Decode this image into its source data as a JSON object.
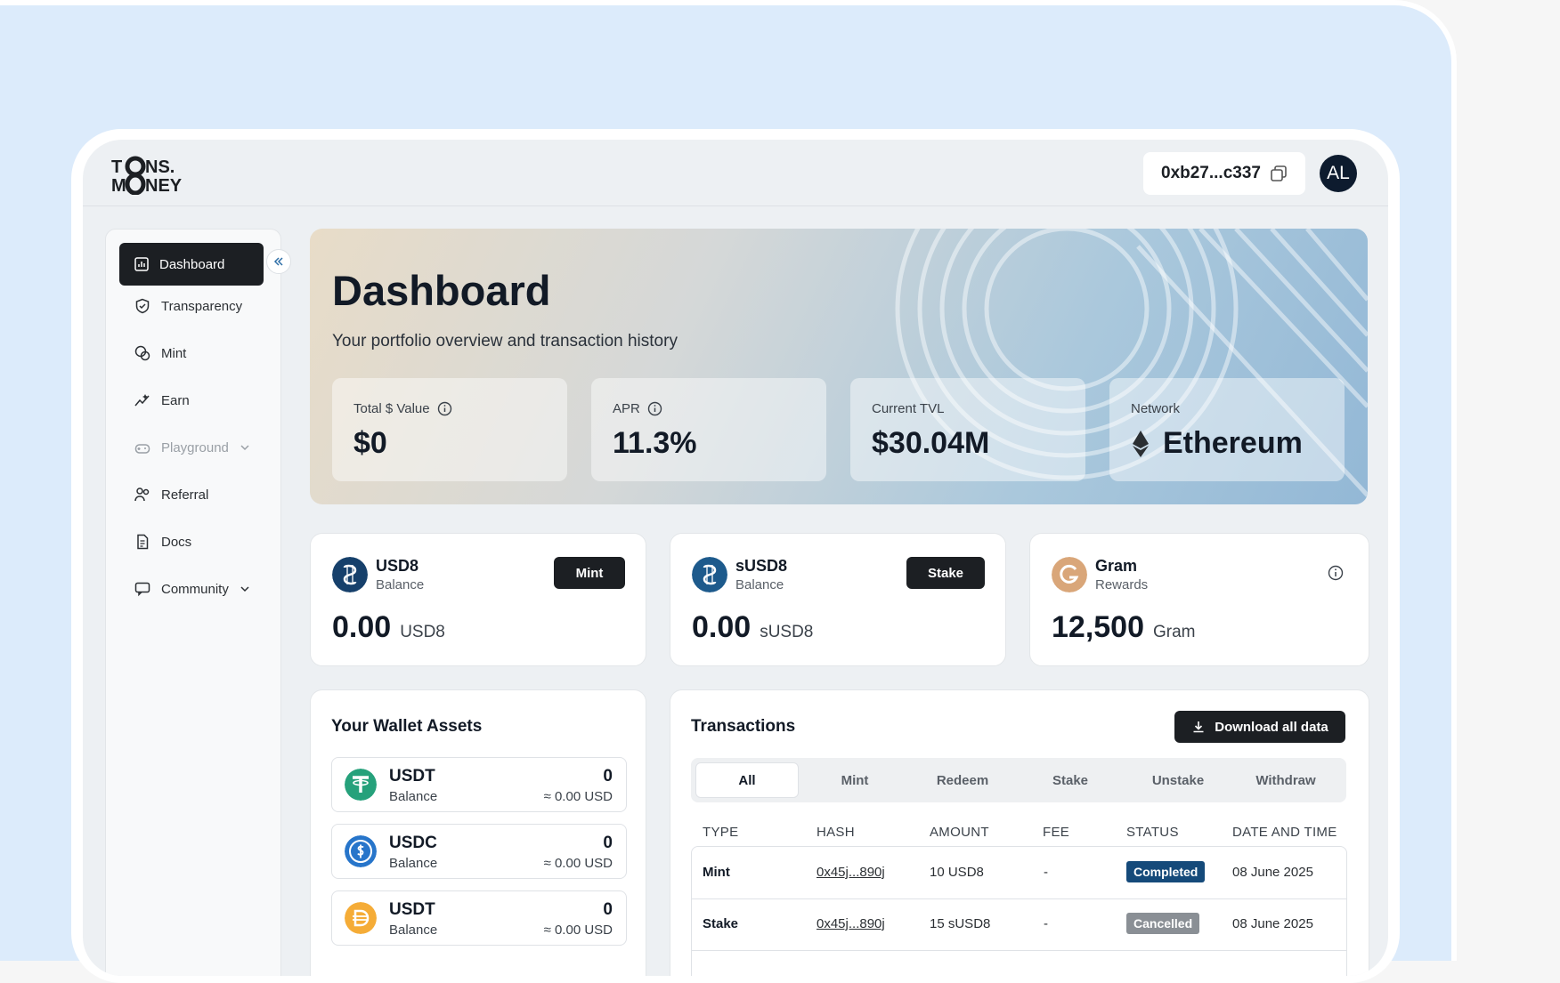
{
  "brand": {
    "logo_line1": "T  NS.",
    "logo_line2": "M  NEY"
  },
  "header": {
    "wallet_address": "0xb27...c337",
    "avatar_initials": "AL"
  },
  "sidebar": {
    "items": [
      {
        "label": "Dashboard",
        "icon": "chart-icon",
        "active": true
      },
      {
        "label": "Transparency",
        "icon": "shield-icon"
      },
      {
        "label": "Mint",
        "icon": "coins-icon"
      },
      {
        "label": "Earn",
        "icon": "sparkline-icon"
      },
      {
        "label": "Playground",
        "icon": "gamepad-icon",
        "muted": true
      },
      {
        "label": "Referral",
        "icon": "users-icon"
      },
      {
        "label": "Docs",
        "icon": "document-icon"
      },
      {
        "label": "Community",
        "icon": "chat-icon"
      }
    ]
  },
  "hero": {
    "title": "Dashboard",
    "subtitle": "Your portfolio overview and transaction history",
    "stats": [
      {
        "label": "Total $ Value",
        "value": "$0"
      },
      {
        "label": "APR",
        "value": "11.3%"
      },
      {
        "label": "Current TVL",
        "value": "$30.04M"
      },
      {
        "label": "Network",
        "value": "Ethereum"
      }
    ]
  },
  "tokens": [
    {
      "name": "USD8",
      "sub": "Balance",
      "button": "Mint",
      "amount": "0.00",
      "unit": "USD8"
    },
    {
      "name": "sUSD8",
      "sub": "Balance",
      "button": "Stake",
      "amount": "0.00",
      "unit": "sUSD8"
    },
    {
      "name": "Gram",
      "sub": "Rewards",
      "amount": "12,500",
      "unit": "Gram"
    }
  ],
  "assets": {
    "title": "Your Wallet Assets",
    "rows": [
      {
        "name": "USDT",
        "sub": "Balance",
        "value": "0",
        "usd": "≈ 0.00 USD",
        "color": "#26a17b"
      },
      {
        "name": "USDC",
        "sub": "Balance",
        "value": "0",
        "usd": "≈ 0.00 USD",
        "color": "#2775ca"
      },
      {
        "name": "USDT",
        "sub": "Balance",
        "value": "0",
        "usd": "≈ 0.00 USD",
        "color": "#f5ac37"
      }
    ]
  },
  "transactions": {
    "title": "Transactions",
    "download_label": "Download all data",
    "tabs": [
      "All",
      "Mint",
      "Redeem",
      "Stake",
      "Unstake",
      "Withdraw"
    ],
    "columns": [
      "TYPE",
      "HASH",
      "AMOUNT",
      "FEE",
      "STATUS",
      "DATE AND TIME"
    ],
    "rows": [
      {
        "type": "Mint",
        "hash": "0x45j...890j",
        "amount": "10 USD8",
        "fee": "-",
        "status": "Completed",
        "status_color": "#154a7a",
        "date": "08 June 2025"
      },
      {
        "type": "Stake",
        "hash": "0x45j...890j",
        "amount": "15 sUSD8",
        "fee": "-",
        "status": "Cancelled",
        "status_color": "#8a8f95",
        "date": "08 June 2025"
      }
    ]
  }
}
